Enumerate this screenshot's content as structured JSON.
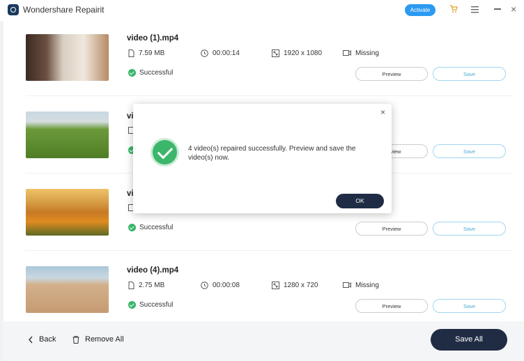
{
  "window": {
    "title": "Wondershare Repairit",
    "activate_label": "Activate",
    "close_glyph": "×"
  },
  "icons": {
    "logo": "repairit-logo-icon",
    "cart": "cart-icon",
    "menu": "hamburger-menu-icon",
    "minimize": "minimize-icon",
    "close": "close-icon"
  },
  "videos": [
    {
      "name": "video (1).mp4",
      "size": "7.59  MB",
      "duration": "00:00:14",
      "resolution": "1920 x 1080",
      "codec": "Missing",
      "status": "Successful",
      "preview": "Preview",
      "save": "Save"
    },
    {
      "name": "vi",
      "status": "",
      "preview": "Preview",
      "save": "Save"
    },
    {
      "name": "vi",
      "status": "Successful",
      "preview": "Preview",
      "save": "Save"
    },
    {
      "name": "video (4).mp4",
      "size": "2.75  MB",
      "duration": "00:00:08",
      "resolution": "1280 x 720",
      "codec": "Missing",
      "status": "Successful",
      "preview": "Preview",
      "save": "Save"
    }
  ],
  "footer": {
    "back": "Back",
    "remove_all": "Remove All",
    "save_all": "Save All"
  },
  "dialog": {
    "message": "4 video(s) repaired successfully. Preview and save the video(s) now.",
    "ok": "OK",
    "close_glyph": "×"
  },
  "colors": {
    "accent": "#2b9af0",
    "success": "#38b56a",
    "dark_button": "#1f2c44",
    "save_outline": "#9fd7ee"
  }
}
